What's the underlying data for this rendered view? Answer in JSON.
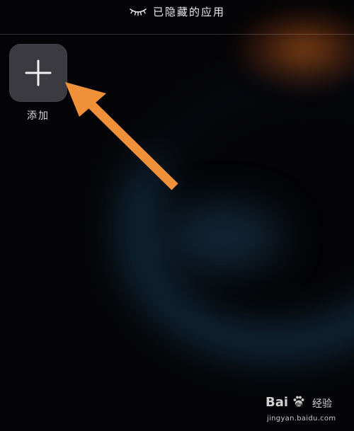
{
  "header": {
    "title": "已隐藏的应用",
    "icon": "closed-eye-icon"
  },
  "add_tile": {
    "icon": "plus-icon",
    "label": "添加"
  },
  "annotation": {
    "icon": "arrow-icon",
    "color": "#f0913a"
  },
  "watermark": {
    "brand_prefix": "Bai",
    "brand_suffix": "",
    "icon": "paw-icon",
    "jingyan": "经验",
    "url": "jingyan.baidu.com"
  },
  "colors": {
    "background": "#040406",
    "tile": "#3a3a40",
    "text": "#e9e9ee",
    "arrow": "#f0913a"
  }
}
